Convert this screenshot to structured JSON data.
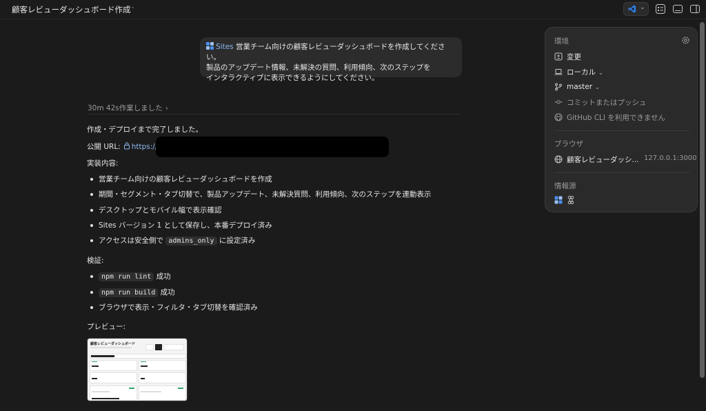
{
  "header": {
    "title": "顧客レビューダッシュボード作成",
    "more": "···"
  },
  "prompt": {
    "tag": "Sites",
    "line1": "営業チーム向けの顧客レビューダッシュボードを作成してください。",
    "line2": "製品のアップデート情報、未解決の質問、利用傾向、次のステップを",
    "line3": "インタラクティブに表示できるようにしてください。"
  },
  "worked": "30m 42s作業しました",
  "response": {
    "done": "作成・デプロイまで完了しました。",
    "url_label": "公開 URL:",
    "url_text": "https://",
    "impl_heading": "実装内容:",
    "impl_items": [
      "営業チーム向けの顧客レビューダッシュボードを作成",
      "期間・セグメント・タブ切替で、製品アップデート、未解決質問、利用傾向、次のステップを連動表示",
      "デスクトップとモバイル幅で表示確認",
      "Sites バージョン 1 として保存し、本番デプロイ済み"
    ],
    "access_prefix": "アクセスは安全側で",
    "access_code": "admins_only",
    "access_suffix": "に設定済み",
    "verify_heading": "検証:",
    "lint_code": "npm run lint",
    "lint_suffix": "成功",
    "build_code": "npm run build",
    "build_suffix": "成功",
    "browser_check": "ブラウザで表示・フィルタ・タブ切替を確認済み",
    "preview_heading": "プレビュー:",
    "preview_title": "顧客レビューダッシュボード"
  },
  "panel": {
    "env_heading": "環境",
    "changes": "変更",
    "local": "ローカル",
    "branch": "master",
    "commit": "コミットまたはプッシュ",
    "github": "GitHub CLI を利用できません",
    "browser_heading": "ブラウザ",
    "browser_tab": "顧客レビューダッシ...",
    "browser_addr": "127.0.0.1:3000",
    "sources_heading": "情報源"
  },
  "colors": {
    "background": "#1b1b1b",
    "link": "#8cb7f0",
    "panel": "#2a2a2a",
    "vscode_blue": "#2f80ed"
  }
}
